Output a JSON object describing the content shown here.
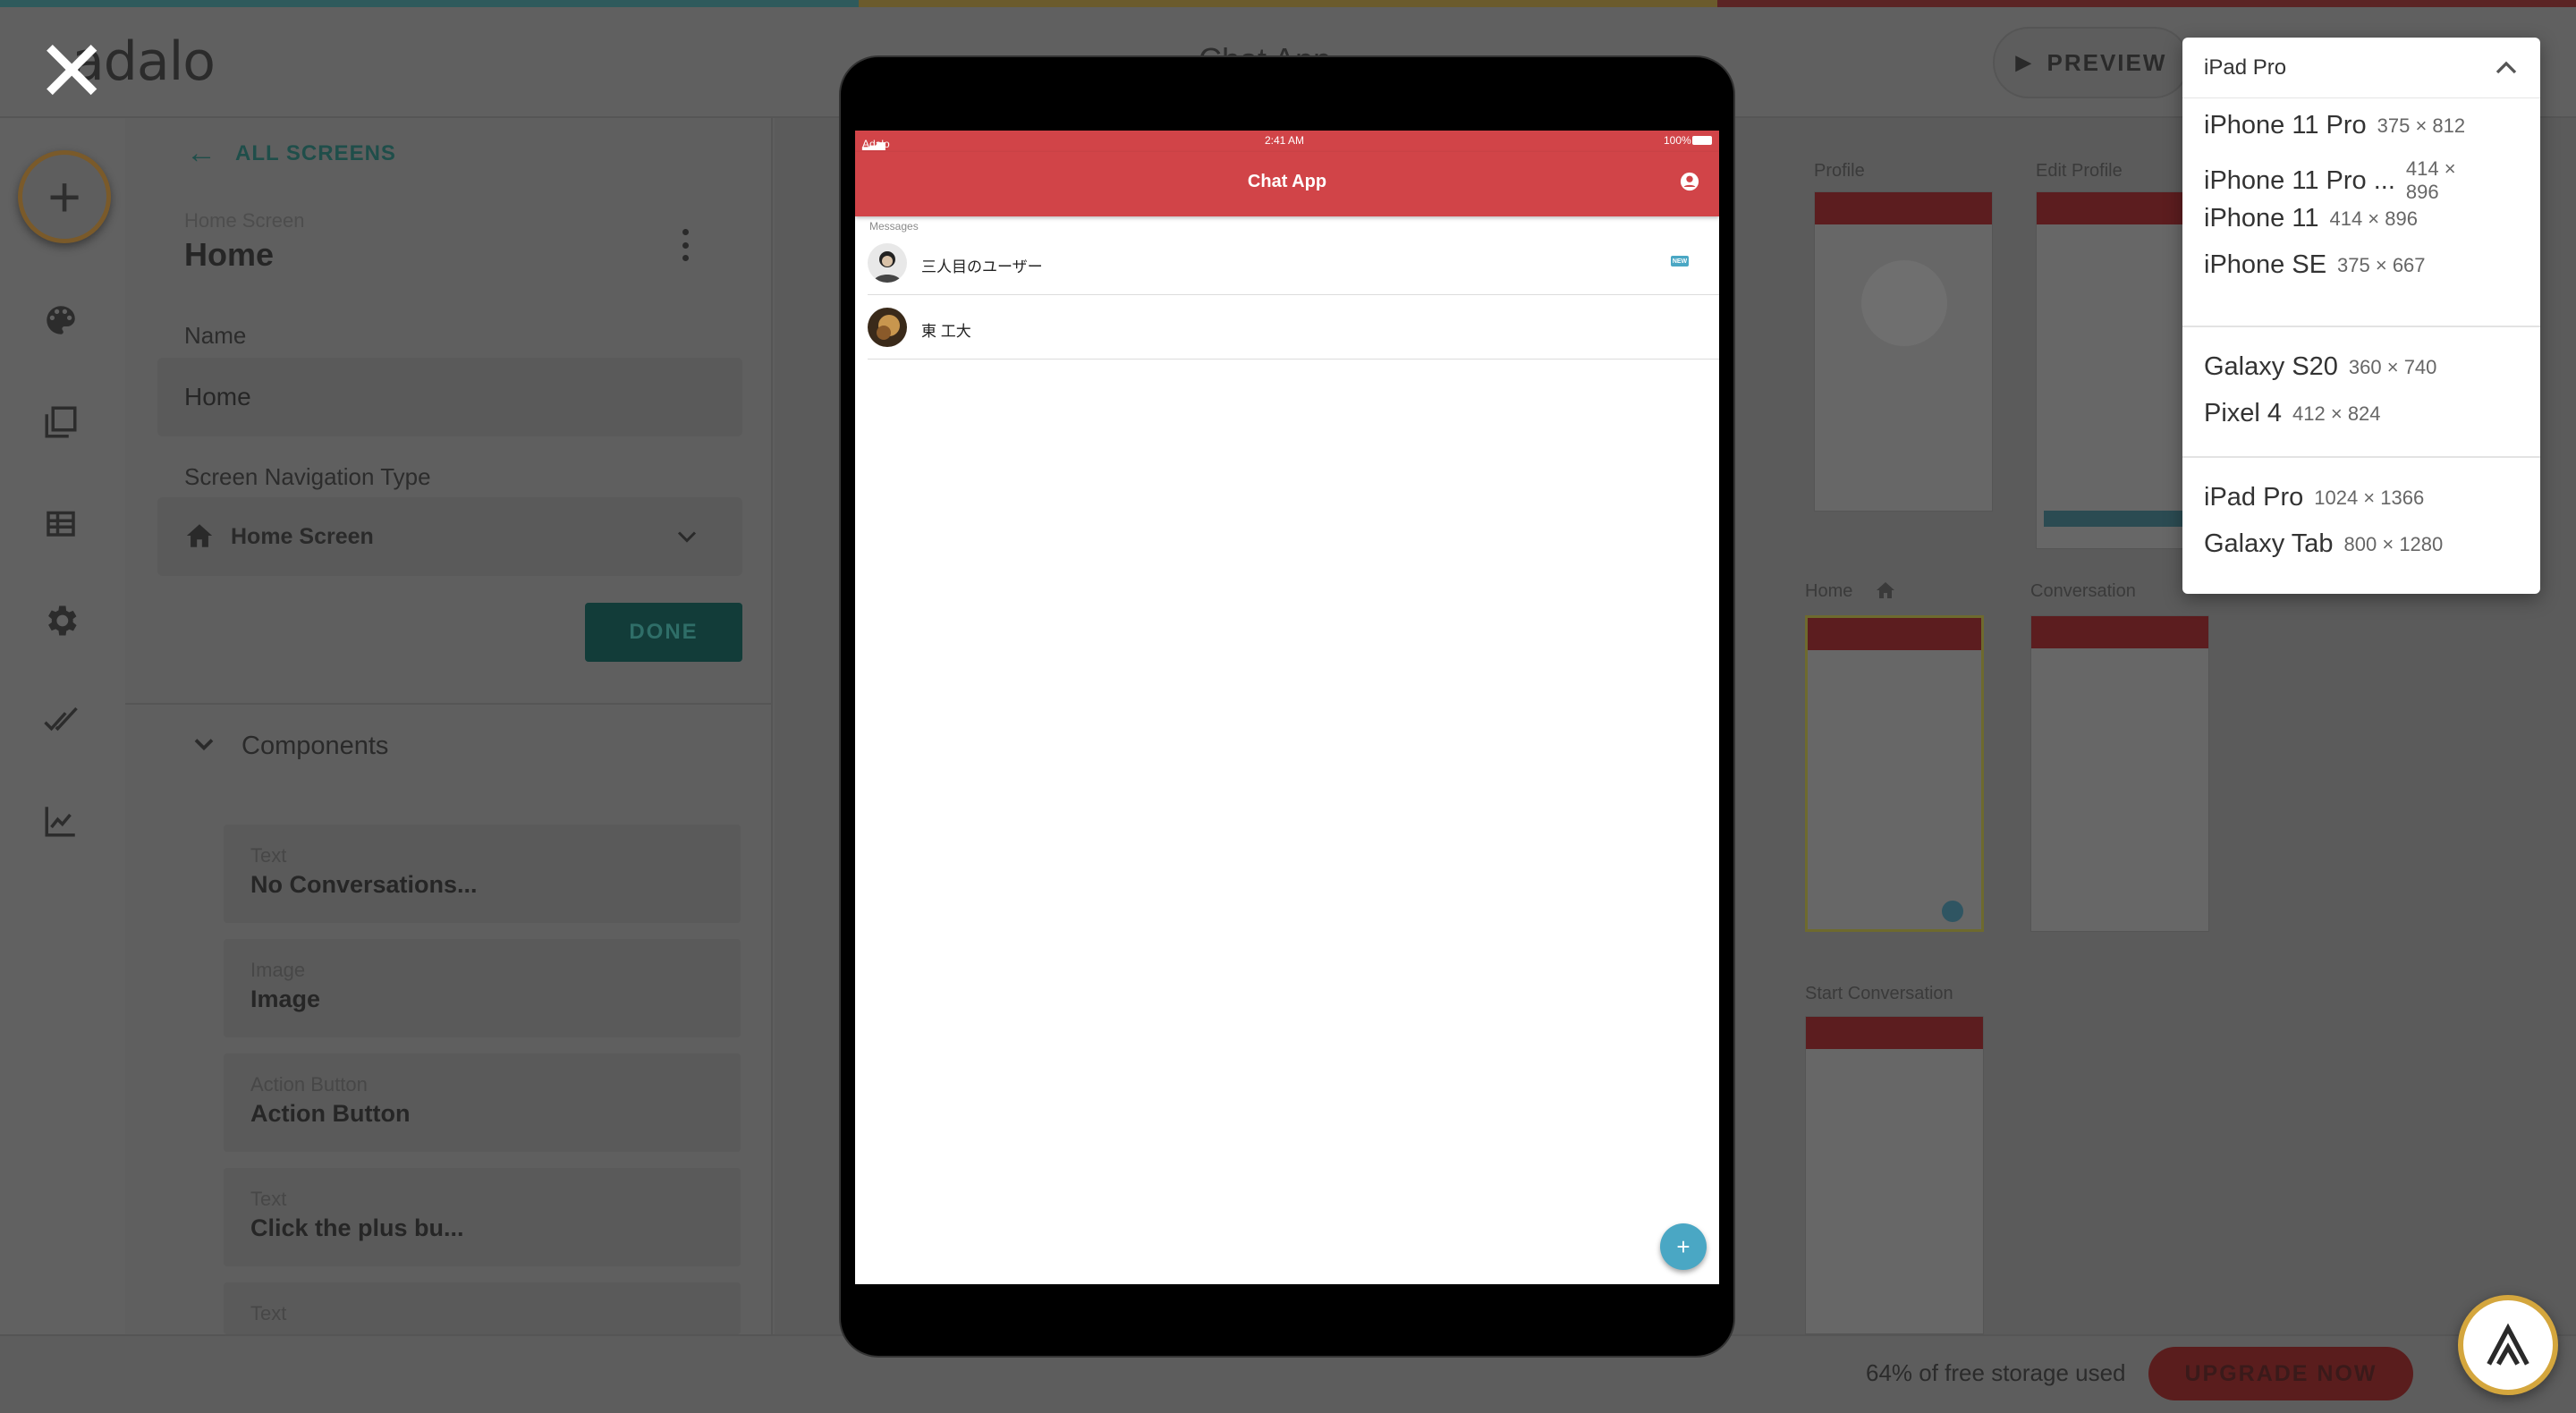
{
  "header": {
    "logo_text": "adalo",
    "app_title": "Chat App",
    "preview_label": "PREVIEW"
  },
  "topbar_colors": [
    "#2e5a5c",
    "#6b5b2c",
    "#5b2424"
  ],
  "left_panel": {
    "back_label": "ALL SCREENS",
    "screen_kind_label": "Home Screen",
    "screen_title": "Home",
    "name_label": "Name",
    "name_value": "Home",
    "nav_type_label": "Screen Navigation Type",
    "nav_type_value": "Home Screen",
    "done_label": "DONE",
    "components_label": "Components",
    "components": [
      {
        "type": "Text",
        "name": "No Conversations..."
      },
      {
        "type": "Image",
        "name": "Image"
      },
      {
        "type": "Action Button",
        "name": "Action Button"
      },
      {
        "type": "Text",
        "name": "Click the plus bu..."
      },
      {
        "type": "Text",
        "name": ""
      }
    ]
  },
  "canvas": {
    "screens": [
      "Profile",
      "Edit Profile",
      "Home",
      "Conversation",
      "Start Conversation"
    ]
  },
  "device_preview": {
    "status_carrier": "Adalo",
    "status_time": "2:41 AM",
    "status_battery": "100%",
    "app_title": "Chat App",
    "section_label": "Messages",
    "messages": [
      {
        "name": "三人目のユーザー",
        "badge": "NEW"
      },
      {
        "name": "東 工大",
        "badge": ""
      }
    ],
    "fab_label": "+",
    "accent_color": "#d14448",
    "fab_color": "#4aa7c4"
  },
  "device_dropdown": {
    "selected": "iPad Pro",
    "groups": [
      [
        {
          "name": "iPhone 11 Pro",
          "size": "375 × 812"
        },
        {
          "name": "iPhone 11 Pro ...",
          "size": "414 × 896"
        },
        {
          "name": "iPhone 11",
          "size": "414 × 896"
        },
        {
          "name": "iPhone SE",
          "size": "375 × 667"
        }
      ],
      [
        {
          "name": "Galaxy S20",
          "size": "360 × 740"
        },
        {
          "name": "Pixel 4",
          "size": "412 × 824"
        }
      ],
      [
        {
          "name": "iPad Pro",
          "size": "1024 × 1366"
        },
        {
          "name": "Galaxy Tab",
          "size": "800 × 1280"
        }
      ]
    ]
  },
  "footer": {
    "storage_text": "64% of free storage used",
    "upgrade_label": "UPGRADE NOW"
  }
}
